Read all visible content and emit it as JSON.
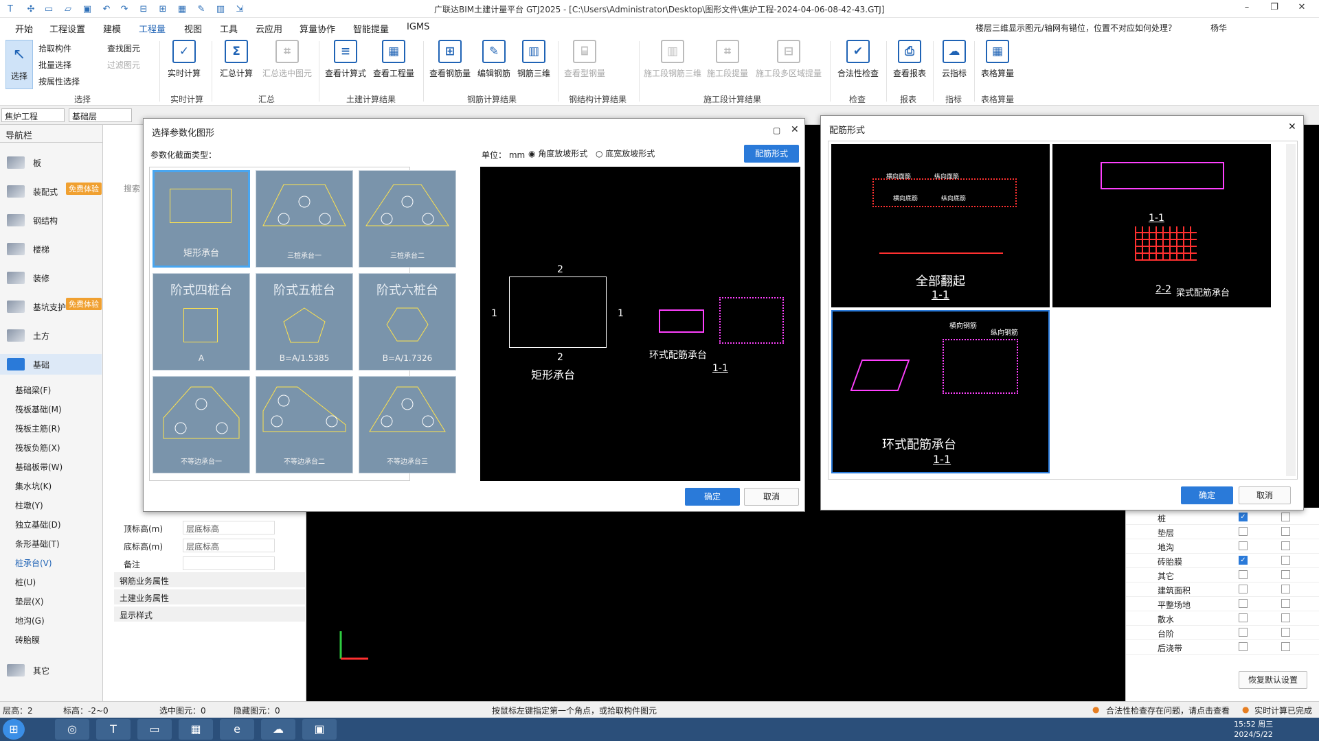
{
  "window": {
    "title": "广联达BIM土建计量平台 GTJ2025 - [C:\\Users\\Administrator\\Desktop\\图形文件\\焦炉工程-2024-04-06-08-42-43.GTJ]"
  },
  "menu": {
    "items": [
      "开始",
      "工程设置",
      "建模",
      "工程量",
      "视图",
      "工具",
      "云应用",
      "算量协作",
      "智能提量",
      "IGMS"
    ],
    "help_text": "楼层三维显示图元/轴网有错位，位置不对应如何处理？",
    "user": "杨华"
  },
  "ribbon": {
    "select": "选择",
    "pick": "拾取构件",
    "batch": "批量选择",
    "byattr": "按属性选择",
    "find": "查找图元",
    "filter": "过滤图元",
    "buttons": [
      "实时计算",
      "汇总计算",
      "汇总选中图元",
      "查看计算式",
      "查看工程量",
      "查看钢筋量",
      "编辑钢筋",
      "钢筋三维",
      "查看型钢量",
      "施工段钢筋三维",
      "施工段提量",
      "施工段多区域提量",
      "合法性检查",
      "查看报表",
      "云指标",
      "表格算量"
    ],
    "groups": [
      "选择",
      "实时计算",
      "汇总",
      "土建计算结果",
      "钢筋计算结果",
      "钢结构计算结果",
      "施工段计算结果",
      "检查",
      "报表",
      "指标",
      "表格算量"
    ]
  },
  "toolrow": {
    "project": "焦炉工程",
    "floor": "基础层"
  },
  "nav": {
    "title": "导航栏",
    "cats": [
      "板",
      "装配式",
      "钢结构",
      "楼梯",
      "装修",
      "基坑支护",
      "土方",
      "基础",
      "其它"
    ],
    "badge": "免费体验",
    "subs": [
      "基础梁(F)",
      "筏板基础(M)",
      "筏板主筋(R)",
      "筏板负筋(X)",
      "基础板带(W)",
      "集水坑(K)",
      "柱墩(Y)",
      "独立基础(D)",
      "条形基础(T)",
      "桩承台(V)",
      "桩(U)",
      "垫层(X)",
      "地沟(G)",
      "砖胎膜"
    ]
  },
  "props": {
    "search": "搜索",
    "rows": [
      {
        "k": "顶标高(m)",
        "v": "层底标高"
      },
      {
        "k": "底标高(m)",
        "v": "层底标高"
      },
      {
        "k": "备注",
        "v": ""
      }
    ],
    "groups": [
      "钢筋业务属性",
      "土建业务属性",
      "显示样式"
    ]
  },
  "dlg1": {
    "title": "选择参数化图形",
    "type_label": "参数化截面类型：",
    "unit": "单位：  mm",
    "opt1": "角度放坡形式",
    "opt2": "底宽放坡形式",
    "rebar_btn": "配筋形式",
    "ok": "确定",
    "cancel": "取消",
    "tiles": [
      "矩形承台",
      "三桩承台一",
      "三桩承台二",
      "阶式四桩台",
      "阶式五桩台",
      "阶式六桩台",
      "不等边承台一",
      "不等边承台二",
      "不等边承台三"
    ],
    "tile_sub": [
      "",
      "",
      "",
      "A",
      "B=A/1.5385",
      "B=A/1.7326"
    ],
    "preview": {
      "n2": "2",
      "n1": "1",
      "name": "矩形承台",
      "sect": "环式配筋承台",
      "sect_no": "1-1"
    }
  },
  "dlg2": {
    "title": "配筋形式",
    "ok": "确定",
    "cancel": "取消",
    "cells": [
      {
        "label": "全部翻起",
        "no": "1-1"
      },
      {
        "label": "梁式配筋承台",
        "no": "2-2"
      },
      {
        "label": "环式配筋承台",
        "no": "1-1"
      }
    ],
    "notes": [
      "横向面筋",
      "纵向面筋",
      "横向底筋",
      "纵向底筋",
      "横向钢筋",
      "纵向钢筋"
    ]
  },
  "right": {
    "rows": [
      {
        "l": "桩",
        "a": true
      },
      {
        "l": "垫层",
        "a": false
      },
      {
        "l": "地沟",
        "a": false
      },
      {
        "l": "砖胎膜",
        "a": true
      },
      {
        "l": "其它",
        "a": false
      },
      {
        "l": "建筑面积",
        "a": false
      },
      {
        "l": "平整场地",
        "a": false
      },
      {
        "l": "散水",
        "a": false
      },
      {
        "l": "台阶",
        "a": false
      },
      {
        "l": "后浇带",
        "a": false
      }
    ],
    "reset": "恢复默认设置"
  },
  "status": {
    "floor": "层高：2",
    "elev": "标高：-2~0",
    "selected": "选中图元：0",
    "hidden": "隐藏图元：0",
    "hint": "按鼠标左键指定第一个角点，或拾取构件图元",
    "check": "合法性检查存在问题，请点击查看",
    "calc": "实时计算已完成"
  },
  "clock": {
    "time": "15:52 周三",
    "date": "2024/5/22"
  },
  "colors": {
    "accent": "#2a7ad9",
    "tile": "#7a94ab"
  }
}
